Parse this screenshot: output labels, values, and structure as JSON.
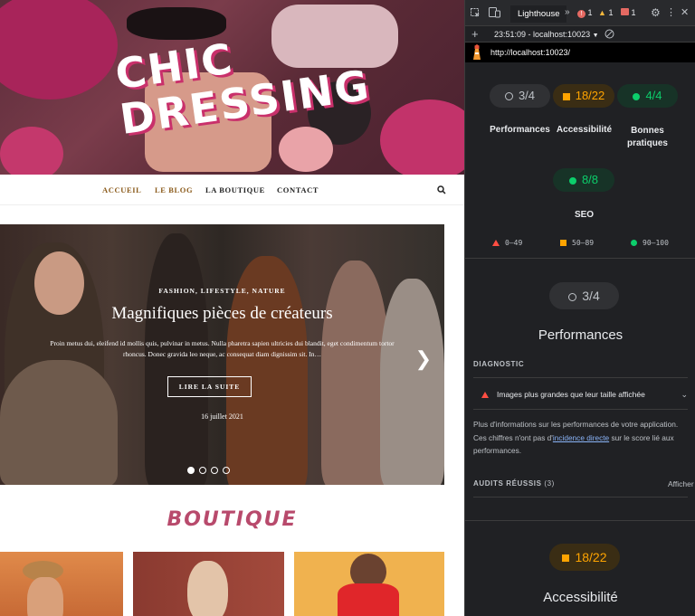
{
  "site": {
    "logo_line1": "CHIC",
    "logo_line2": "DRESSING",
    "nav": [
      "ACCUEIL",
      "LE BLOG",
      "LA BOUTIQUE",
      "CONTACT"
    ],
    "slide": {
      "category": "FASHION, LIFESTYLE, NATURE",
      "title": "Magnifiques pièces de créateurs",
      "excerpt": "Proin metus dui, eleifend id mollis quis, pulvinar in metus. Nulla pharetra sapien ultricies dui blandit, eget condimentum tortor rhoncus. Donec gravida leo neque, ac consequat diam dignissim sit. In…",
      "button": "LIRE LA SUITE",
      "date": "16 juillet 2021"
    },
    "section_title": "BOUTIQUE",
    "colors": {
      "accent": "#b84a6c",
      "nav_active": "#8a5a1a"
    }
  },
  "devtools": {
    "tab": "Lighthouse",
    "errors": "1",
    "warnings": "1",
    "messages": "1",
    "report_time": "23:51:09 - localhost:10023",
    "url": "http://localhost:10023/",
    "scores": [
      {
        "value": "3/4",
        "label": "Performances",
        "level": "neutral"
      },
      {
        "value": "18/22",
        "label": "Accessibilité",
        "level": "average"
      },
      {
        "value": "4/4",
        "label": "Bonnes pratiques",
        "level": "pass"
      },
      {
        "value": "8/8",
        "label": "SEO",
        "level": "pass"
      }
    ],
    "legend": [
      "0–49",
      "50–89",
      "90–100"
    ],
    "perf_section": {
      "score": "3/4",
      "title": "Performances",
      "diagnostic_heading": "DIAGNOSTIC",
      "diagnostic_item": "Images plus grandes que leur taille affichée",
      "info_part1": "Plus d'informations sur les performances de votre application. Ces chiffres n'ont pas d'",
      "info_link": "incidence directe",
      "info_part2": " sur le score lié aux performances.",
      "passed_audits": "AUDITS RÉUSSIS",
      "passed_count": "(3)",
      "show": "Afficher"
    },
    "a11y_section": {
      "score": "18/22",
      "title": "Accessibilité"
    }
  }
}
